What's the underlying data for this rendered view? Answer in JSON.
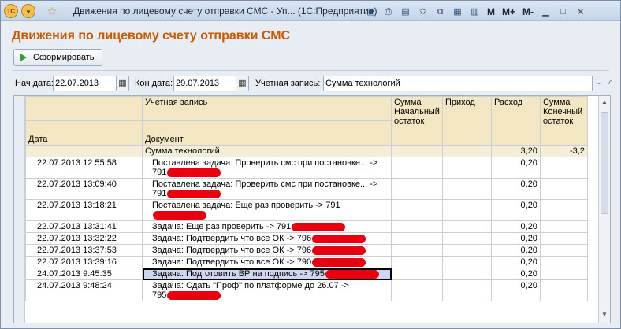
{
  "window": {
    "title": "Движения по лицевому счету отправки СМС - Уп... (1С:Предприятие)",
    "logo_text": "1С",
    "toolbar_text": {
      "m": "M",
      "m_plus": "M+",
      "m_minus": "M-"
    }
  },
  "icons": [
    "logo-icon",
    "main-menu-icon",
    "favorites-star-icon",
    "save-icon",
    "print-icon",
    "preview-icon",
    "add-favorite-icon",
    "bookmark-icon",
    "calculator-icon",
    "calendar-icon",
    "minimize-icon",
    "maximize-icon",
    "close-icon",
    "play-icon",
    "select-icon",
    "search-icon"
  ],
  "form": {
    "heading": "Движения по лицевому счету отправки СМС",
    "generate_button": "Сформировать",
    "date_from_label": "Нач дата:",
    "date_from": "22.07.2013",
    "date_to_label": "Кон дата:",
    "date_to": "29.07.2013",
    "account_label": "Учетная запись:",
    "account_value": "Сумма технологий",
    "select_button": "...",
    "colors": {
      "heading": "#c85a00",
      "header_bg": "#f3e7c3",
      "redaction": "#e8000e"
    }
  },
  "report": {
    "headers": {
      "account": "Учетная запись",
      "date": "Дата",
      "document": "Документ",
      "opening": "Сумма Начальный остаток",
      "income": "Приход",
      "expense": "Расход",
      "closing": "Сумма Конечный остаток"
    },
    "group": {
      "name": "Сумма технологий",
      "expense": "3,20",
      "closing": "-3,2"
    },
    "rows": [
      {
        "date": "22.07.2013 12:55:58",
        "doc1": "Поставлена задача: Проверить смс при постановке... ->",
        "doc2": "791",
        "expense": "0,20"
      },
      {
        "date": "22.07.2013 13:09:40",
        "doc1": "Поставлена задача: Проверить смс при постановке... ->",
        "doc2": "791",
        "expense": "0,20"
      },
      {
        "date": "22.07.2013 13:18:21",
        "doc1": "Поставлена задача: Еще раз проверить -> 791",
        "expense": "0,20"
      },
      {
        "date": "22.07.2013 13:31:41",
        "doc1": "Задача: Еще раз проверить -> 791",
        "expense": "0,20"
      },
      {
        "date": "22.07.2013 13:32:22",
        "doc1": "Задача: Подтвердить что все ОК -> 796",
        "expense": "0,20"
      },
      {
        "date": "22.07.2013 13:37:53",
        "doc1": "Задача: Подтвердить что все ОК -> 796",
        "expense": "0,20"
      },
      {
        "date": "22.07.2013 13:39:16",
        "doc1": "Задача: Подтвердить что все ОК -> 790",
        "expense": "0,20"
      },
      {
        "date": "24.07.2013 9:45:35",
        "doc1": "Задача: Подготовить ВР на подпись -> 795",
        "expense": "0,20",
        "selected": true
      },
      {
        "date": "24.07.2013 9:48:24",
        "doc1": "Задача: Сдать \"Проф\" по платформе до 26.07 ->",
        "doc2": "795",
        "expense": "0,20"
      }
    ]
  }
}
